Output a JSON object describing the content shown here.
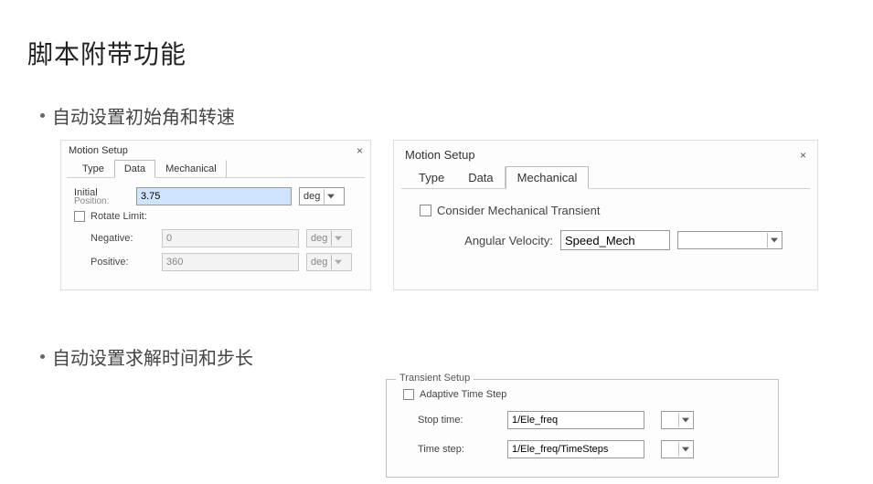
{
  "page": {
    "title": "脚本附带功能"
  },
  "section1": {
    "bullet": "自动设置初始角和转速",
    "panelA": {
      "title": "Motion Setup",
      "tabs": {
        "type": "Type",
        "data": "Data",
        "mechanical": "Mechanical"
      },
      "initial": {
        "label": "Initial",
        "sublabel": "Position:",
        "value": "3.75",
        "unit": "deg"
      },
      "rotateLimit": {
        "label": "Rotate Limit:"
      },
      "negative": {
        "label": "Negative:",
        "value": "0",
        "unit": "deg"
      },
      "positive": {
        "label": "Positive:",
        "value": "360",
        "unit": "deg"
      }
    },
    "panelB": {
      "title": "Motion Setup",
      "tabs": {
        "type": "Type",
        "data": "Data",
        "mechanical": "Mechanical"
      },
      "consider": {
        "label": "Consider Mechanical Transient"
      },
      "angVel": {
        "label": "Angular Velocity:",
        "value": "Speed_Mech",
        "unit": ""
      }
    }
  },
  "section2": {
    "bullet": "自动设置求解时间和步长",
    "fieldset": {
      "legend": "Transient Setup",
      "adaptive": {
        "label": "Adaptive Time Step"
      },
      "stopTime": {
        "label": "Stop time:",
        "value": "1/Ele_freq",
        "unit": ""
      },
      "timeStep": {
        "label": "Time step:",
        "value": "1/Ele_freq/TimeSteps",
        "unit": ""
      }
    }
  }
}
